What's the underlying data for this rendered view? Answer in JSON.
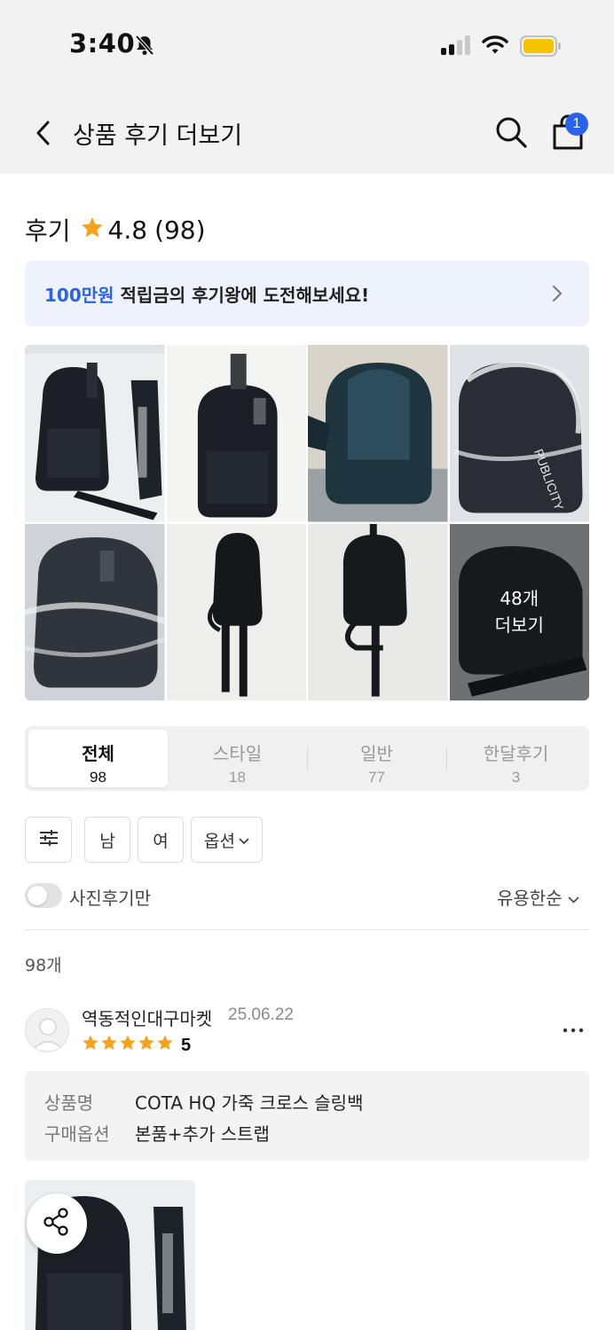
{
  "status_bar": {
    "time": "3:40",
    "icons": [
      "bell-slash-icon",
      "cellular-signal-icon",
      "wifi-icon",
      "battery-icon"
    ],
    "battery_color": "#f5c400"
  },
  "header": {
    "title": "상품 후기 더보기",
    "cart_badge": "1"
  },
  "summary": {
    "label": "후기",
    "rating": "4.8",
    "count": "(98)"
  },
  "banner": {
    "highlight": "100만원",
    "text": " 적립금의 후기왕에 도전해보세요!"
  },
  "photo_grid": {
    "more_count": "48개",
    "more_label": "더보기"
  },
  "tabs": [
    {
      "label": "전체",
      "count": "98",
      "active": true
    },
    {
      "label": "스타일",
      "count": "18",
      "active": false
    },
    {
      "label": "일반",
      "count": "77",
      "active": false
    },
    {
      "label": "한달후기",
      "count": "3",
      "active": false
    }
  ],
  "filters": {
    "male": "남",
    "female": "여",
    "option": "옵션"
  },
  "photo_only": {
    "label": "사진후기만",
    "enabled": false
  },
  "sort": {
    "selected": "유용한순"
  },
  "result_count": "98개",
  "review": {
    "reviewer": "역동적인대구마켓",
    "date": "25.06.22",
    "stars": 5,
    "score": "5",
    "product_label": "상품명",
    "product_name": "COTA HQ 가죽 크로스 슬링백",
    "option_label": "구매옵션",
    "option_value": "본품+추가 스트랩"
  },
  "colors": {
    "accent": "#2a62ec",
    "star": "#f7a21b",
    "banner_bg": "#eef2fd"
  }
}
